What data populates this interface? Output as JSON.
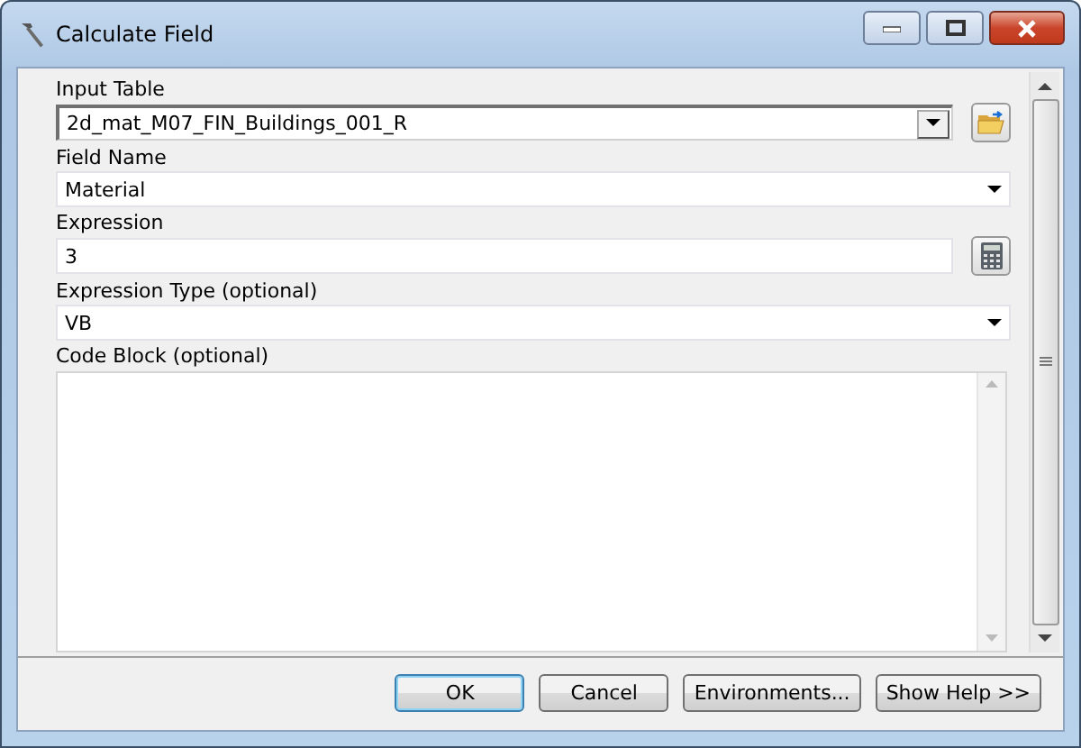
{
  "window": {
    "title": "Calculate Field"
  },
  "fields": [
    {
      "label": "Input Table",
      "kind": "table_picker",
      "value": "2d_mat_M07_FIN_Buildings_001_R"
    },
    {
      "label": "Field Name",
      "kind": "dropdown",
      "value": "Material"
    },
    {
      "label": "Expression",
      "kind": "expression",
      "value": "3"
    },
    {
      "label": "Expression Type (optional)",
      "kind": "dropdown",
      "value": "VB"
    },
    {
      "label": "Code Block (optional)",
      "kind": "textarea"
    }
  ],
  "buttons": [
    {
      "label": "OK",
      "default": true
    },
    {
      "label": "Cancel",
      "default": false
    },
    {
      "label": "Environments...",
      "default": false
    },
    {
      "label": "Show Help >>",
      "default": false
    }
  ]
}
